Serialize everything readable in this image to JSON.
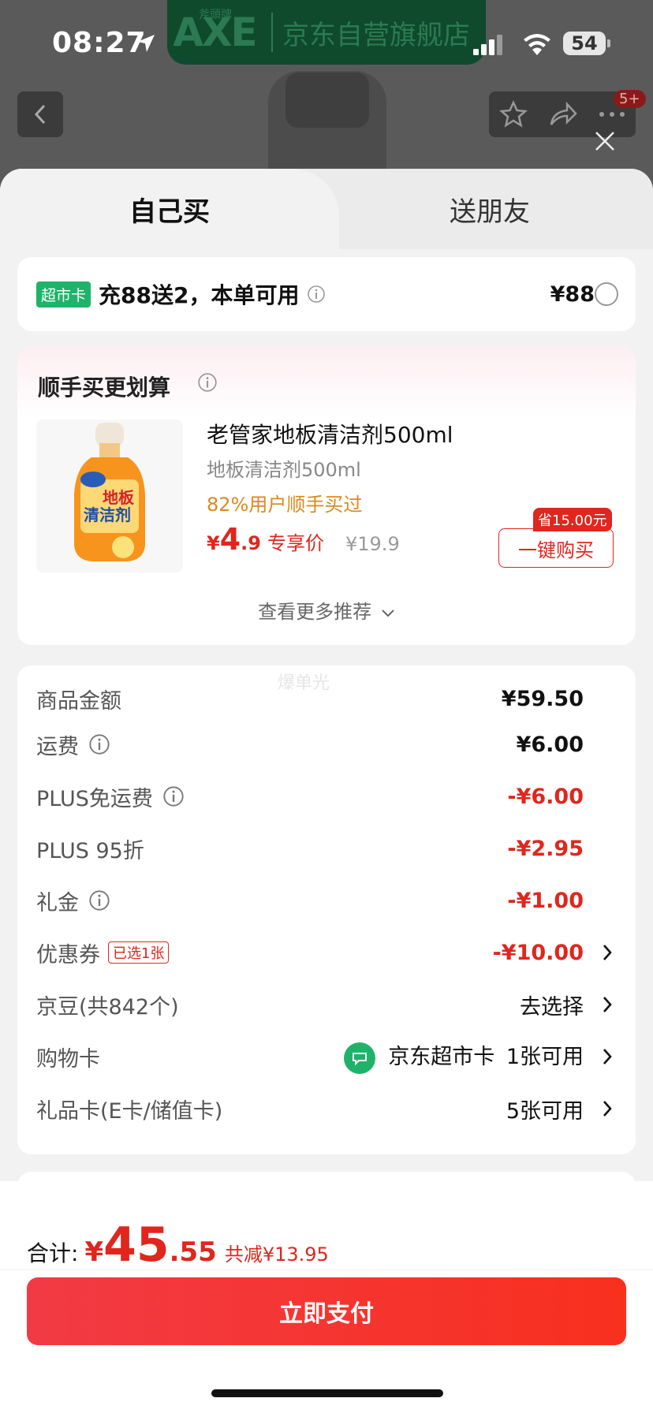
{
  "status_bar": {
    "time": "08:27",
    "battery": "54"
  },
  "background": {
    "brand_logo_small": "斧頭牌",
    "brand_logo": "AXE",
    "store_name": "京东自营旗舰店",
    "notification_badge": "5+"
  },
  "tabs": [
    {
      "label": "自己买"
    },
    {
      "label": "送朋友"
    }
  ],
  "promo": {
    "tag": "超市卡",
    "text": "充88送2，本单可用",
    "price": "¥88"
  },
  "recommend": {
    "title": "顺手买更划算",
    "product": {
      "name": "老管家地板清洁剂500ml",
      "spec": "地板清洁剂500ml",
      "buyers": "82%用户顺手买过",
      "price_currency": "¥",
      "price_int": "4",
      "price_dec": ".9",
      "price_label": "专享价",
      "original_price": "¥19.9",
      "save_badge": "省15.00元",
      "buy_button": "一键购买",
      "img_label_1": "地板",
      "img_label_2": "清洁剂"
    },
    "more": "查看更多推荐"
  },
  "fees": {
    "watermark": "爆单光",
    "goods_amount": {
      "label": "商品金额",
      "value": "¥59.50"
    },
    "shipping": {
      "label": "运费",
      "value": "¥6.00"
    },
    "plus_free_shipping": {
      "label": "PLUS免运费",
      "value": "-¥6.00"
    },
    "plus_discount": {
      "label": "PLUS 95折",
      "value": "-¥2.95"
    },
    "gift_money": {
      "label": "礼金",
      "value": "-¥1.00"
    },
    "coupon": {
      "label": "优惠券",
      "tag": "已选1张",
      "value": "-¥10.00"
    },
    "jd_beans": {
      "label": "京豆(共842个)",
      "value": "去选择"
    },
    "shopping_card": {
      "label": "购物卡",
      "card_name": "京东超市卡",
      "value": "1张可用"
    },
    "gift_card": {
      "label": "礼品卡(E卡/储值卡)",
      "value": "5张可用"
    }
  },
  "footer": {
    "total_label": "合计:",
    "total_currency": "¥",
    "total_int": "45",
    "total_dec": ".55",
    "total_saved": "共减¥13.95",
    "pay_button": "立即支付"
  },
  "colors": {
    "accent_red": "#e0261d",
    "green": "#1fb36a",
    "orange_text": "#d98a1f"
  }
}
